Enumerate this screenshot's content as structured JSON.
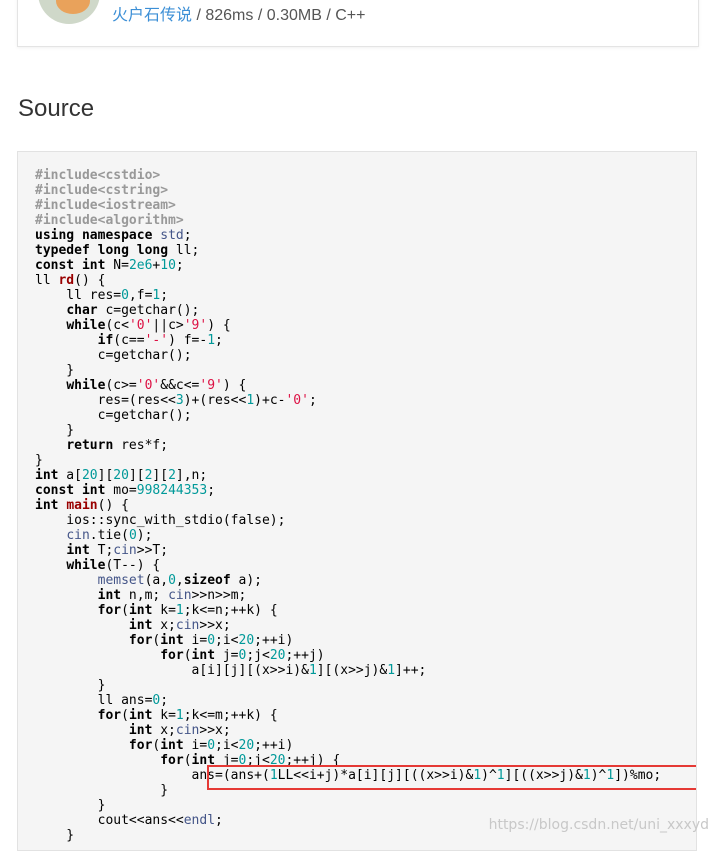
{
  "submission": {
    "username": "火户石传说",
    "time": "826ms",
    "memory": "0.30MB",
    "language": "C++",
    "separator": " / "
  },
  "section": {
    "title": "Source"
  },
  "watermark": "https://blog.csdn.net/uni_xxxyd",
  "colors": {
    "link": "#3c8fd6",
    "highlight_border": "#e53935",
    "code_bg": "#f5f5f5"
  },
  "code_lines": [
    "#include<cstdio>",
    "#include<cstring>",
    "#include<iostream>",
    "#include<algorithm>",
    "using namespace std;",
    "typedef long long ll;",
    "const int N=2e6+10;",
    "ll rd() {",
    "    ll res=0,f=1;",
    "    char c=getchar();",
    "    while(c<'0'||c>'9') {",
    "        if(c=='-') f=-1;",
    "        c=getchar();",
    "    }",
    "    while(c>='0'&&c<='9') {",
    "        res=(res<<3)+(res<<1)+c-'0';",
    "        c=getchar();",
    "    }",
    "    return res*f;",
    "}",
    "int a[20][20][2][2],n;",
    "const int mo=998244353;",
    "int main() {",
    "    ios::sync_with_stdio(false);",
    "    cin.tie(0);",
    "    int T;cin>>T;",
    "    while(T--) {",
    "        memset(a,0,sizeof a);",
    "        int n,m; cin>>n>>m;",
    "        for(int k=1;k<=n;++k) {",
    "            int x;cin>>x;",
    "            for(int i=0;i<20;++i)",
    "                for(int j=0;j<20;++j)",
    "                    a[i][j][(x>>i)&1][(x>>j)&1]++;",
    "        }",
    "        ll ans=0;",
    "        for(int k=1;k<=m;++k) {",
    "            int x;cin>>x;",
    "            for(int i=0;i<20;++i)",
    "                for(int j=0;j<20;++j) {",
    "                    ans=(ans+(1LL<<i+j)*a[i][j][((x>>i)&1)^1][((x>>j)&1)^1])%mo;",
    "                }",
    "        }",
    "        cout<<ans<<endl;",
    "    }"
  ]
}
